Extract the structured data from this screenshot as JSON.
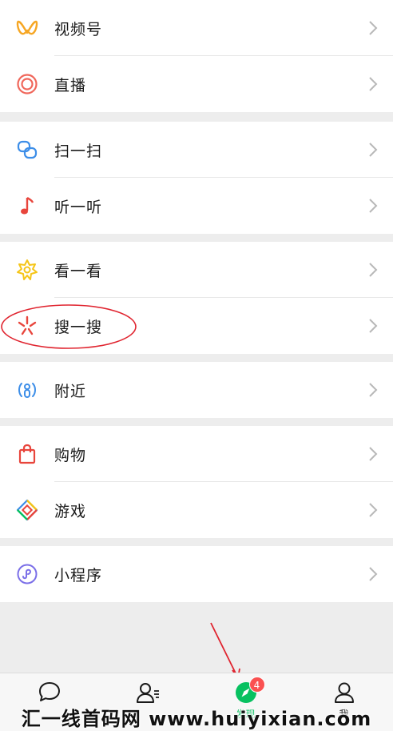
{
  "menu_groups": [
    {
      "items": [
        {
          "label": "视频号",
          "icon": "channels-icon"
        },
        {
          "label": "直播",
          "icon": "live-icon"
        }
      ]
    },
    {
      "items": [
        {
          "label": "扫一扫",
          "icon": "scan-icon"
        },
        {
          "label": "听一听",
          "icon": "music-note-icon"
        }
      ]
    },
    {
      "items": [
        {
          "label": "看一看",
          "icon": "top-stories-icon"
        },
        {
          "label": "搜一搜",
          "icon": "search-sparkle-icon"
        }
      ]
    },
    {
      "items": [
        {
          "label": "附近",
          "icon": "nearby-icon"
        }
      ]
    },
    {
      "items": [
        {
          "label": "购物",
          "icon": "shopping-bag-icon"
        },
        {
          "label": "游戏",
          "icon": "games-icon"
        }
      ]
    },
    {
      "items": [
        {
          "label": "小程序",
          "icon": "mini-programs-icon"
        }
      ]
    }
  ],
  "tabbar": {
    "tabs": [
      {
        "label": "",
        "icon": "chat-bubble-icon"
      },
      {
        "label": "",
        "icon": "contacts-icon"
      },
      {
        "label": "发现",
        "icon": "discover-compass-icon",
        "badge": "4"
      },
      {
        "label": "我",
        "icon": "me-icon"
      }
    ]
  },
  "watermark": {
    "text": "汇一线首码网 www.huiyixian.com"
  },
  "colors": {
    "accent": "#07c160",
    "badge": "#fa5151",
    "annotation": "#e0242f",
    "background": "#ededed"
  }
}
